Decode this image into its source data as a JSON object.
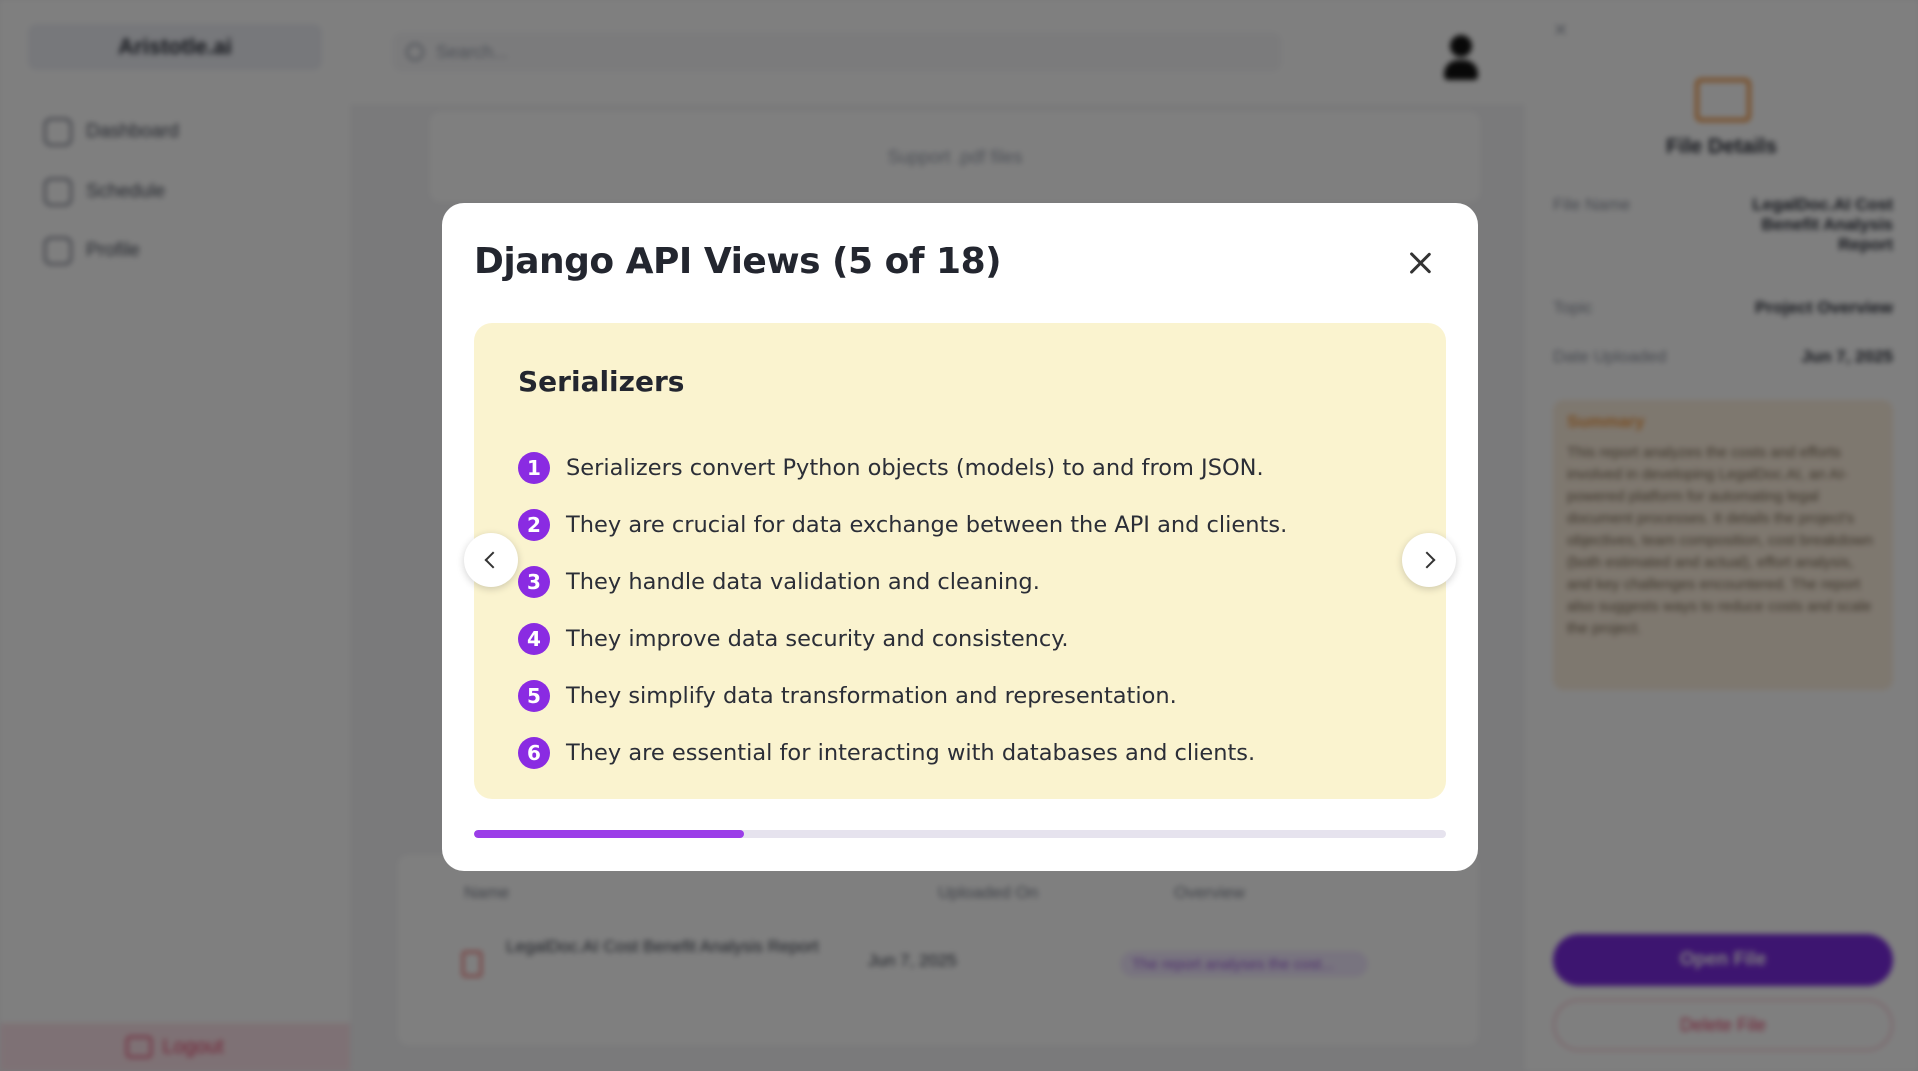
{
  "app": {
    "brand": "Aristotle.ai",
    "search_placeholder": "Search...",
    "sidebar": {
      "items": [
        {
          "label": "Dashboard",
          "icon": "dashboard-icon"
        },
        {
          "label": "Schedule",
          "icon": "calendar-icon"
        },
        {
          "label": "Profile",
          "icon": "profile-icon"
        }
      ],
      "logout_label": "Logout"
    },
    "upload_hint": "Support .pdf files",
    "table": {
      "headers": [
        "Name",
        "Uploaded On",
        "Overview"
      ],
      "row": {
        "name": "LegalDoc.AI Cost Benefit Analysis Report",
        "uploaded": "Jun 7, 2025",
        "overview": "The report analyses the cost..."
      }
    },
    "details": {
      "close": "✕",
      "title": "File Details",
      "rows": [
        {
          "key": "File Name",
          "value": "LegalDoc.AI Cost Benefit Analysis Report"
        },
        {
          "key": "Topic",
          "value": "Project Overview"
        },
        {
          "key": "Date Uploaded",
          "value": "Jun 7, 2025"
        }
      ],
      "summary_label": "Summary",
      "summary_text": "This report analyzes the costs and efforts involved in developing LegalDoc.AI, an AI-powered platform for automating legal document processes. It details the project's objectives, team composition, cost breakdown (both estimated and actual), effort analysis, and key challenges encountered. The report also suggests ways to reduce costs and scale the project.",
      "open_label": "Open File",
      "delete_label": "Delete File"
    }
  },
  "modal": {
    "title": "Django API Views (5 of 18)",
    "slide": {
      "title": "Serializers",
      "points": [
        {
          "num": "1",
          "text": "Serializers convert Python objects (models) to and from JSON."
        },
        {
          "num": "2",
          "text": "They are crucial for data exchange between the API and clients."
        },
        {
          "num": "3",
          "text": "They handle data validation and cleaning."
        },
        {
          "num": "4",
          "text": "They improve data security and consistency."
        },
        {
          "num": "5",
          "text": "They simplify data transformation and representation."
        },
        {
          "num": "6",
          "text": "They are essential for interacting with databases and clients."
        }
      ]
    },
    "progress": {
      "current": 5,
      "total": 18,
      "fraction": 0.278
    }
  },
  "colors": {
    "accent": "#8a2be2",
    "slide_bg": "#faf3cf",
    "progress_fill": "#9b3ee8"
  }
}
